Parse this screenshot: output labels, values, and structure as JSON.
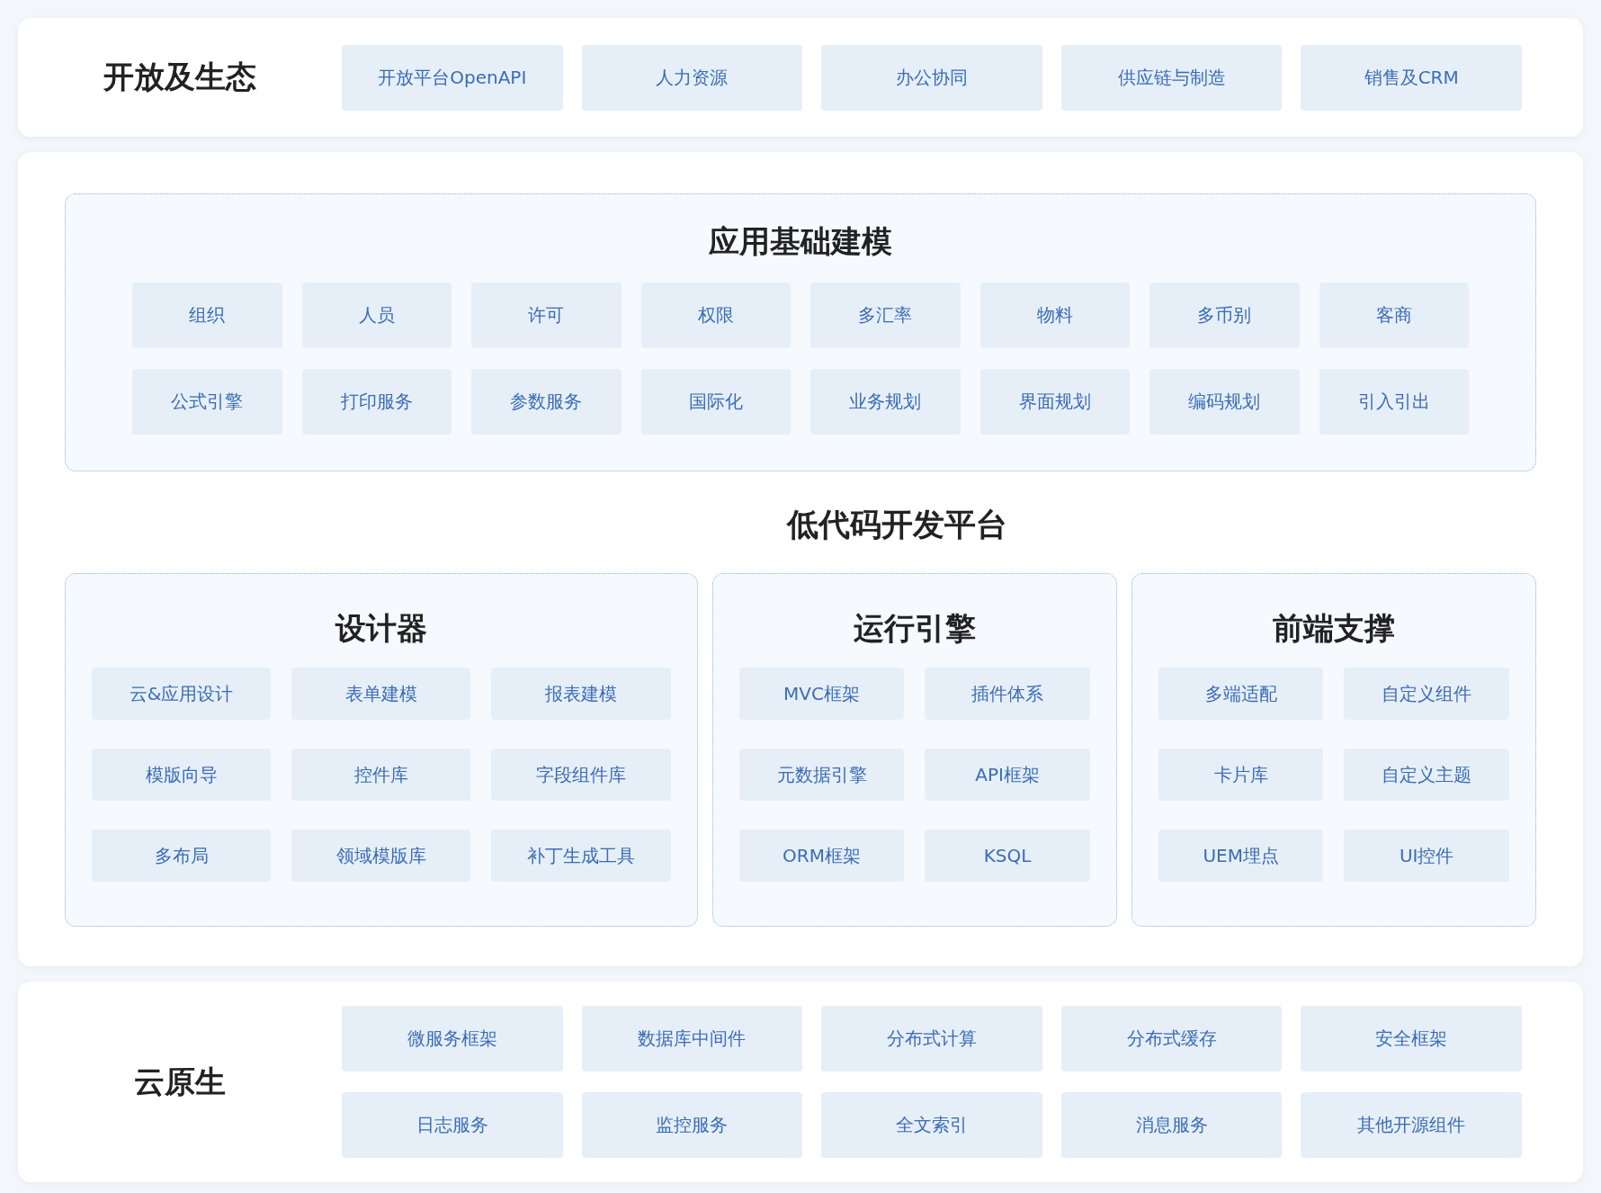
{
  "ecosystem": {
    "title": "开放及生态",
    "items": [
      "开放平台OpenAPI",
      "人力资源",
      "办公协同",
      "供应链与制造",
      "销售及CRM"
    ]
  },
  "platform": {
    "foundation": {
      "title": "应用基础建模",
      "items": [
        "组织",
        "人员",
        "许可",
        "权限",
        "多汇率",
        "物料",
        "多币别",
        "客商",
        "公式引擎",
        "打印服务",
        "参数服务",
        "国际化",
        "业务规划",
        "界面规划",
        "编码规划",
        "引入引出"
      ]
    },
    "title": "低代码开发平台",
    "modules": [
      {
        "title": "设计器",
        "items": [
          "云&应用设计",
          "表单建模",
          "报表建模",
          "模版向导",
          "控件库",
          "字段组件库",
          "多布局",
          "领域模版库",
          "补丁生成工具"
        ]
      },
      {
        "title": "运行引擎",
        "items": [
          "MVC框架",
          "插件体系",
          "元数据引擎",
          "API框架",
          "ORM框架",
          "KSQL"
        ]
      },
      {
        "title": "前端支撑",
        "items": [
          "多端适配",
          "自定义组件",
          "卡片库",
          "自定义主题",
          "UEM埋点",
          "UI控件"
        ]
      }
    ]
  },
  "cloud_native": {
    "title": "云原生",
    "items": [
      "微服务框架",
      "数据库中间件",
      "分布式计算",
      "分布式缓存",
      "安全框架",
      "日志服务",
      "监控服务",
      "全文索引",
      "消息服务",
      "其他开源组件"
    ]
  }
}
